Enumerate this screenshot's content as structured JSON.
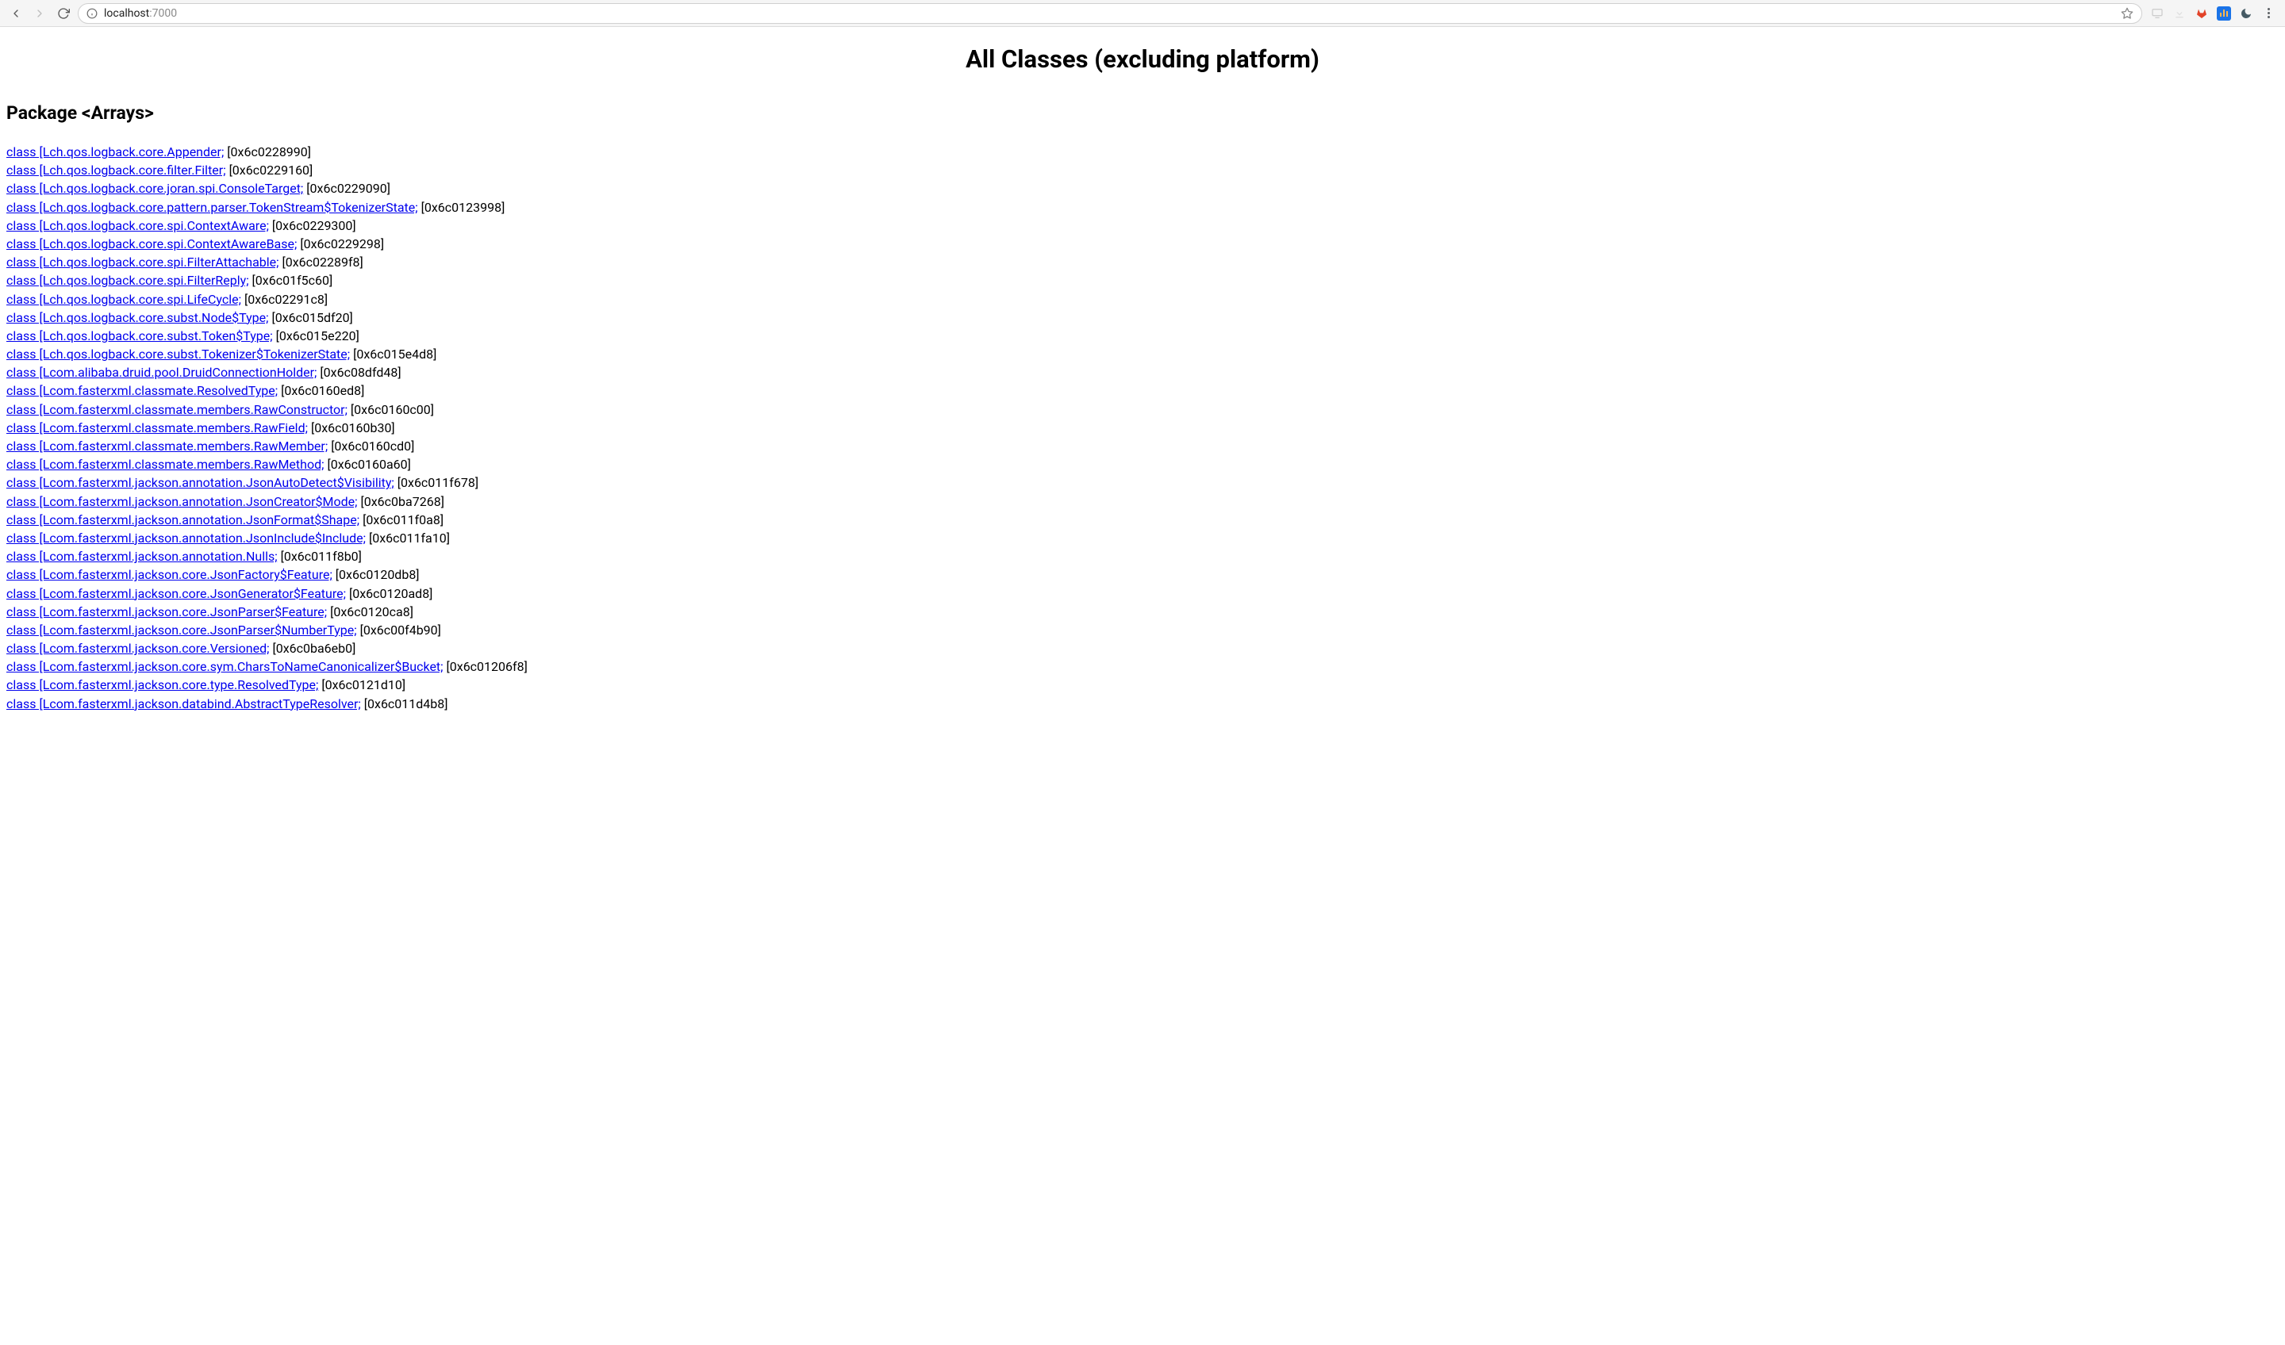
{
  "browser": {
    "url_host": "localhost",
    "url_port": ":7000"
  },
  "content": {
    "title": "All Classes (excluding platform)",
    "package_heading": "Package <Arrays>",
    "classes": [
      {
        "link": "class [Lch.qos.logback.core.Appender;",
        "addr": " [0x6c0228990]"
      },
      {
        "link": "class [Lch.qos.logback.core.filter.Filter;",
        "addr": " [0x6c0229160]"
      },
      {
        "link": "class [Lch.qos.logback.core.joran.spi.ConsoleTarget;",
        "addr": " [0x6c0229090]"
      },
      {
        "link": "class [Lch.qos.logback.core.pattern.parser.TokenStream$TokenizerState;",
        "addr": " [0x6c0123998]"
      },
      {
        "link": "class [Lch.qos.logback.core.spi.ContextAware;",
        "addr": " [0x6c0229300]"
      },
      {
        "link": "class [Lch.qos.logback.core.spi.ContextAwareBase;",
        "addr": " [0x6c0229298]"
      },
      {
        "link": "class [Lch.qos.logback.core.spi.FilterAttachable;",
        "addr": " [0x6c02289f8]"
      },
      {
        "link": "class [Lch.qos.logback.core.spi.FilterReply;",
        "addr": " [0x6c01f5c60]"
      },
      {
        "link": "class [Lch.qos.logback.core.spi.LifeCycle;",
        "addr": " [0x6c02291c8]"
      },
      {
        "link": "class [Lch.qos.logback.core.subst.Node$Type;",
        "addr": " [0x6c015df20]"
      },
      {
        "link": "class [Lch.qos.logback.core.subst.Token$Type;",
        "addr": " [0x6c015e220]"
      },
      {
        "link": "class [Lch.qos.logback.core.subst.Tokenizer$TokenizerState;",
        "addr": " [0x6c015e4d8]"
      },
      {
        "link": "class [Lcom.alibaba.druid.pool.DruidConnectionHolder;",
        "addr": " [0x6c08dfd48]"
      },
      {
        "link": "class [Lcom.fasterxml.classmate.ResolvedType;",
        "addr": " [0x6c0160ed8]"
      },
      {
        "link": "class [Lcom.fasterxml.classmate.members.RawConstructor;",
        "addr": " [0x6c0160c00]"
      },
      {
        "link": "class [Lcom.fasterxml.classmate.members.RawField;",
        "addr": " [0x6c0160b30]"
      },
      {
        "link": "class [Lcom.fasterxml.classmate.members.RawMember;",
        "addr": " [0x6c0160cd0]"
      },
      {
        "link": "class [Lcom.fasterxml.classmate.members.RawMethod;",
        "addr": " [0x6c0160a60]"
      },
      {
        "link": "class [Lcom.fasterxml.jackson.annotation.JsonAutoDetect$Visibility;",
        "addr": " [0x6c011f678]"
      },
      {
        "link": "class [Lcom.fasterxml.jackson.annotation.JsonCreator$Mode;",
        "addr": " [0x6c0ba7268]"
      },
      {
        "link": "class [Lcom.fasterxml.jackson.annotation.JsonFormat$Shape;",
        "addr": " [0x6c011f0a8]"
      },
      {
        "link": "class [Lcom.fasterxml.jackson.annotation.JsonInclude$Include;",
        "addr": " [0x6c011fa10]"
      },
      {
        "link": "class [Lcom.fasterxml.jackson.annotation.Nulls;",
        "addr": " [0x6c011f8b0]"
      },
      {
        "link": "class [Lcom.fasterxml.jackson.core.JsonFactory$Feature;",
        "addr": " [0x6c0120db8]"
      },
      {
        "link": "class [Lcom.fasterxml.jackson.core.JsonGenerator$Feature;",
        "addr": " [0x6c0120ad8]"
      },
      {
        "link": "class [Lcom.fasterxml.jackson.core.JsonParser$Feature;",
        "addr": " [0x6c0120ca8]"
      },
      {
        "link": "class [Lcom.fasterxml.jackson.core.JsonParser$NumberType;",
        "addr": " [0x6c00f4b90]"
      },
      {
        "link": "class [Lcom.fasterxml.jackson.core.Versioned;",
        "addr": " [0x6c0ba6eb0]"
      },
      {
        "link": "class [Lcom.fasterxml.jackson.core.sym.CharsToNameCanonicalizer$Bucket;",
        "addr": " [0x6c01206f8]"
      },
      {
        "link": "class [Lcom.fasterxml.jackson.core.type.ResolvedType;",
        "addr": " [0x6c0121d10]"
      },
      {
        "link": "class [Lcom.fasterxml.jackson.databind.AbstractTypeResolver;",
        "addr": " [0x6c011d4b8]"
      }
    ]
  }
}
